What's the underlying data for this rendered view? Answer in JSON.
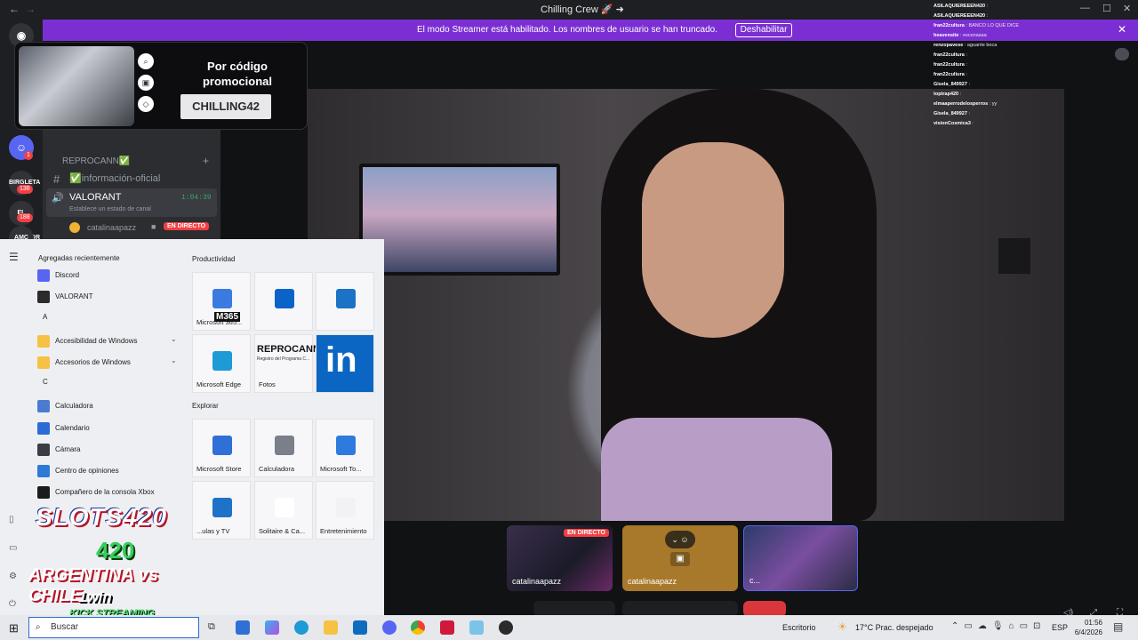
{
  "titlebar": {
    "title": "Chilling Crew 🚀 ➜",
    "back": "←",
    "forward": "→"
  },
  "banner": {
    "message": "El modo Streamer está habilitado. Los nombres de usuario se han truncado.",
    "button": "Deshabilitar"
  },
  "rail": {
    "badges": [
      "1",
      "136",
      "188"
    ],
    "servers": [
      "BIRGLETA",
      "EL JUGADOR",
      "AMC"
    ]
  },
  "promo": {
    "heading": "Por código promocional",
    "code": "CHILLING42"
  },
  "channels": {
    "category": "REPROCANN✅",
    "text_channel": "✅información-oficial",
    "voice_channel": "VALORANT",
    "voice_time": "1:04:39",
    "voice_status": "Establece un estado de canal",
    "member": "catalinaapazz",
    "live_badge": "EN DIRECTO"
  },
  "chat": [
    {
      "user": "ASILAQUIEREEEN420",
      "msg": ":"
    },
    {
      "user": "ASILAQUIEREEEN420",
      "msg": ":"
    },
    {
      "user": "fran22cultura",
      "msg": ": BANCO LO QUE DICE"
    },
    {
      "user": "heavensite",
      "msg": ": escenasaa"
    },
    {
      "user": "renzopavese",
      "msg": ": aguante boca"
    },
    {
      "user": "fran22cultura",
      "msg": ":"
    },
    {
      "user": "fran22cultura",
      "msg": ":"
    },
    {
      "user": "fran22cultura",
      "msg": ":"
    },
    {
      "user": "Gisela_849927",
      "msg": ":"
    },
    {
      "user": "toptrap420",
      "msg": ":"
    },
    {
      "user": "elmaaperrodelosperros",
      "msg": ": yy"
    },
    {
      "user": "Gisela_849927",
      "msg": ":"
    },
    {
      "user": "visionCosmica3",
      "msg": ":"
    }
  ],
  "start": {
    "recent_header": "Agregadas recientemente",
    "apps": [
      {
        "label": "Discord",
        "color": "#5865f2"
      },
      {
        "label": "VALORANT",
        "color": "#2b2b2b"
      },
      {
        "letter": "A"
      },
      {
        "label": "Accesibilidad de Windows",
        "color": "#f5c244",
        "folder": true
      },
      {
        "label": "Accesorios de Windows",
        "color": "#f5c244",
        "folder": true
      },
      {
        "letter": "C"
      },
      {
        "label": "Calculadora",
        "color": "#4a7bd0"
      },
      {
        "label": "Calendario",
        "color": "#2b6bd6"
      },
      {
        "label": "Cámara",
        "color": "#3a3d44"
      },
      {
        "label": "Centro de opiniones",
        "color": "#2c7ad6"
      },
      {
        "label": "Compañero de la consola Xbox",
        "color": "#1b1b1b"
      }
    ],
    "productivity_header": "Productividad",
    "explore_header": "Explorar",
    "tiles": [
      {
        "label": "Microsoft 365...",
        "badge": "M365",
        "color": "#3b7be0"
      },
      {
        "label": "",
        "color": "#0a64c8"
      },
      {
        "label": "",
        "color": "#1a73c4"
      },
      {
        "label": "Microsoft Edge",
        "color": "#1e9ad6"
      },
      {
        "label": "Fotos",
        "banner": "REPROCANN",
        "sub": "Registro del Programa C...",
        "color": "#fff"
      },
      {
        "label": "",
        "color": "#0a66c2",
        "brand": "in"
      },
      {
        "label": "Microsoft Store",
        "color": "#2f6fd6"
      },
      {
        "label": "Calculadora",
        "color": "#7a7f8a"
      },
      {
        "label": "Microsoft To...",
        "color": "#2e7be0"
      },
      {
        "label": "...ulas y TV",
        "color": "#1e73c8"
      },
      {
        "label": "Solitaire & Ca...",
        "color": "#ffffff"
      },
      {
        "label": "Entretenimiento",
        "color": "#f2f2f4"
      }
    ]
  },
  "slots": {
    "l1": "SLOTS420",
    "l2": "420",
    "l3": "ARGENTINA vs CHILE",
    "l4": "1win",
    "l5": "KICK STREAMING"
  },
  "participants": [
    {
      "name": "catalinaapazz",
      "live": "EN DIRECTO"
    },
    {
      "name": "catalinaapazz"
    },
    {
      "name": "c..."
    }
  ],
  "taskbar": {
    "search_placeholder": "Buscar",
    "desktop": "Escritorio",
    "weather": "17°C  Prac. despejado",
    "lang": "ESP",
    "time": "01:56",
    "date": "6/4/2026"
  }
}
